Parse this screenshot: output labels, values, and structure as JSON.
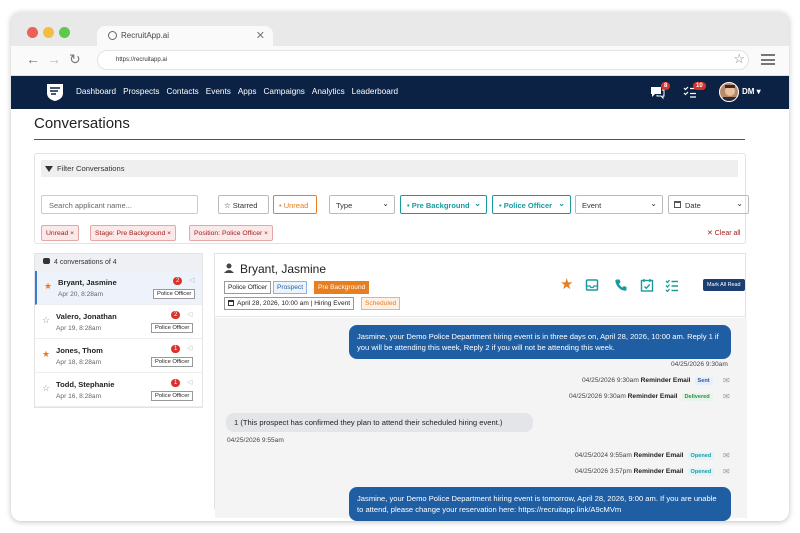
{
  "browser": {
    "tab_title": "RecruitApp.ai",
    "tab_close": "✕",
    "url": "https://recruitapp.ai",
    "back": "←",
    "forward": "→",
    "reload": "↻",
    "bookmark": "☆"
  },
  "nav": {
    "items": [
      "Dashboard",
      "Prospects",
      "Contacts",
      "Events",
      "Apps",
      "Campaigns",
      "Analytics",
      "Leaderboard"
    ],
    "messages_badge": "8",
    "tasks_badge": "10",
    "user_initials": "DM ▾"
  },
  "page": {
    "title": "Conversations"
  },
  "filter": {
    "heading": "Filter Conversations",
    "search_placeholder": "Search applicant name...",
    "starred": "☆ Starred",
    "unread": "• Unread",
    "type": "Type",
    "stage": "• Pre Background",
    "position": "• Police Officer",
    "event": "Event",
    "date": "Date",
    "chips": [
      "Unread ×",
      "Stage: Pre Background ×",
      "Position: Police Officer ×"
    ],
    "clear_all": "✕ Clear all"
  },
  "list": {
    "header": "4 conversations of 4",
    "items": [
      {
        "name": "Bryant, Jasmine",
        "date": "Apr 20, 8:28am",
        "count": "2",
        "tag": "Police Officer",
        "starred": true
      },
      {
        "name": "Valero, Jonathan",
        "date": "Apr 19, 8:28am",
        "count": "2",
        "tag": "Police Officer",
        "starred": false
      },
      {
        "name": "Jones, Thom",
        "date": "Apr 18, 8:28am",
        "count": "1",
        "tag": "Police Officer",
        "starred": true
      },
      {
        "name": "Todd, Stephanie",
        "date": "Apr 16, 8:28am",
        "count": "1",
        "tag": "Police Officer",
        "starred": false
      }
    ]
  },
  "chat": {
    "name": "Bryant, Jasmine",
    "tags": [
      "Police Officer",
      "Prospect",
      "Pre Background"
    ],
    "event": "April 28, 2026, 10:00 am | Hiring Event",
    "event_status": "Scheduled",
    "mark_all_read": "Mark All Read",
    "messages": {
      "m1": "Jasmine, your Demo Police Department hiring event is in three days on, April 28, 2026, 10:00 am. Reply 1 if you will be attending this week, Reply 2 if you will not be attending this week.",
      "m1_time": "04/25/2026 9:30am",
      "r1_time": "04/25/2026 9:30am",
      "r1_label": "Reminder Email",
      "r1_status": "Sent",
      "r2_time": "04/25/2026 9:30am",
      "r2_label": "Reminder Email",
      "r2_status": "Delivered",
      "m2": "1 (This prospect has confirmed they plan to attend their scheduled hiring event.)",
      "m2_time": "04/25/2026 9:55am",
      "r3_time": "04/25/2024 9:55am",
      "r3_label": "Reminder Email",
      "r3_status": "Opened",
      "r4_time": "04/25/2026 3:57pm",
      "r4_label": "Reminder Email",
      "r4_status": "Opened",
      "m3": "Jasmine, your Demo Police Department hiring event is tomorrow, April 28, 2026, 9:00 am. If you are unable to attend, please change your reservation here: https://recruitapp.link/A9cMVm"
    }
  },
  "colors": {
    "nav_bg": "#0c2245",
    "accent_orange": "#e67e22",
    "accent_teal": "#1a9aa0",
    "bubble_blue": "#1f5ea3",
    "badge_red": "#d9342b"
  }
}
